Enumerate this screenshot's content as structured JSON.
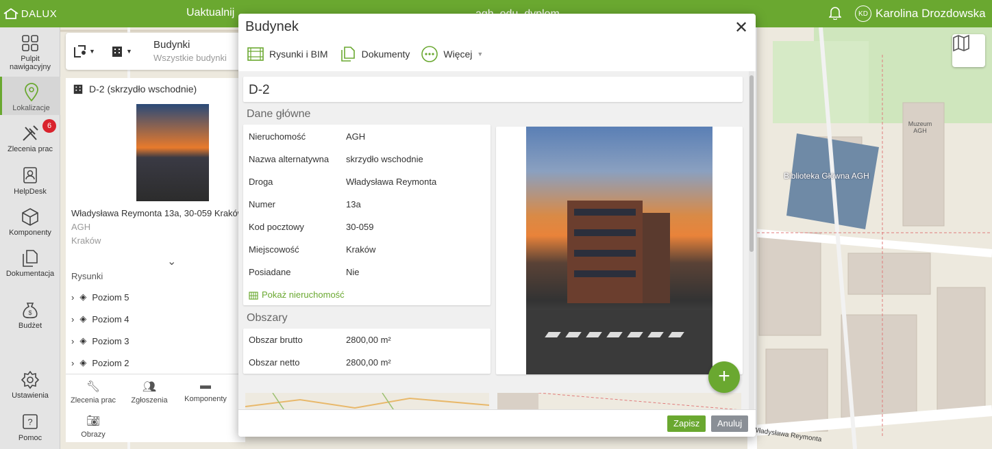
{
  "topbar": {
    "logo_text": "DALUX",
    "update_label": "Uaktualnij",
    "project_label": "agh_edu_dyplom",
    "user_initials": "KD",
    "user_name": "Karolina Drozdowska"
  },
  "leftnav": {
    "items": [
      {
        "label": "Pulpit nawigacyjny",
        "icon": "dashboard-icon"
      },
      {
        "label": "Lokalizacje",
        "icon": "location-pin-icon",
        "active": true
      },
      {
        "label": "Zlecenia prac",
        "icon": "tools-icon",
        "badge": "6"
      },
      {
        "label": "HelpDesk",
        "icon": "helpdesk-icon"
      },
      {
        "label": "Komponenty",
        "icon": "cube-icon"
      },
      {
        "label": "Dokumentacja",
        "icon": "documents-icon"
      },
      {
        "label": "Budżet",
        "icon": "money-bag-icon"
      },
      {
        "label": "Ustawienia",
        "icon": "gear-icon"
      },
      {
        "label": "Pomoc",
        "icon": "help-icon"
      }
    ]
  },
  "buildings_panel": {
    "title": "Budynki",
    "subtitle": "Wszystkie budynki",
    "building_title": "D-2 (skrzydło wschodnie)",
    "address": "Władysława Reymonta 13a, 30-059 Kraków",
    "owner": "AGH",
    "city": "Kraków",
    "drawings_label": "Rysunki",
    "levels": [
      "Poziom 5",
      "Poziom 4",
      "Poziom 3",
      "Poziom 2"
    ],
    "tools": [
      {
        "label": "Zlecenia prac",
        "icon": "wrench-icon"
      },
      {
        "label": "Zgłoszenia",
        "icon": "people-icon"
      },
      {
        "label": "Komponenty",
        "icon": "box-icon"
      },
      {
        "label": "Obrazy",
        "icon": "camera-icon"
      }
    ]
  },
  "modal": {
    "title": "Budynek",
    "toolbar": {
      "drawings_bim": "Rysunki i BIM",
      "documents": "Dokumenty",
      "more": "Więcej"
    },
    "name": "D-2",
    "main_section": "Dane główne",
    "fields": [
      {
        "key": "Nieruchomość",
        "value": "AGH"
      },
      {
        "key": "Nazwa alternatywna",
        "value": "skrzydło wschodnie"
      },
      {
        "key": "Droga",
        "value": "Władysława Reymonta"
      },
      {
        "key": "Numer",
        "value": "13a"
      },
      {
        "key": "Kod pocztowy",
        "value": "30-059"
      },
      {
        "key": "Miejscowość",
        "value": "Kraków"
      },
      {
        "key": "Posiadane",
        "value": "Nie"
      }
    ],
    "show_property_link": "Pokaż nieruchomość",
    "areas_section": "Obszary",
    "areas": [
      {
        "key": "Obszar brutto",
        "value": "2800,00 m²"
      },
      {
        "key": "Obszar netto",
        "value": "2800,00 m²"
      }
    ],
    "save_label": "Zapisz",
    "cancel_label": "Anuluj"
  },
  "map_labels": {
    "library": "Biblioteka Główna AGH",
    "museum": "Muzeum AGH",
    "street": "Władysława Reymonta"
  },
  "colors": {
    "brand_green": "#6aa830",
    "badge_red": "#d9232d",
    "cancel_gray": "#8a8f96"
  }
}
